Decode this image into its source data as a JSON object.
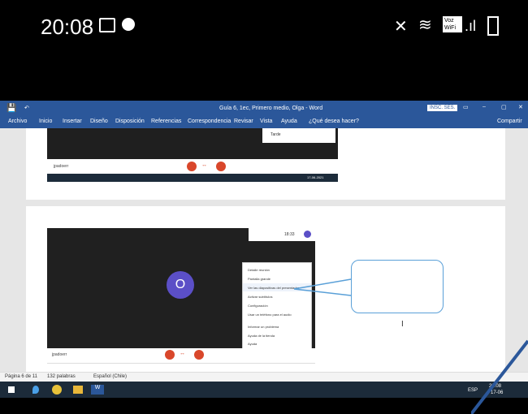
{
  "phone": {
    "time": "20:08",
    "voice_label": "Voz WiFi"
  },
  "word": {
    "title": "Guía 6, 1ec, Primero medio, Olga - Word",
    "badge": "INSC. SES.",
    "share": "Compartir",
    "tell_me": "¿Qué desea hacer?",
    "menu": [
      "Archivo",
      "Inicio",
      "Insertar",
      "Diseño",
      "Disposición",
      "Referencias",
      "Correspondencia",
      "Revisar",
      "Vista",
      "Ayuda"
    ]
  },
  "doc": {
    "top_video": {
      "user": "jpadoerr",
      "popup_item": "Tarde",
      "timestamp_small": "17-06-2021"
    },
    "video": {
      "avatar_letter": "O",
      "user": "jpadoerr",
      "clock": "18:33"
    },
    "menu_items": [
      "Detalle reunión",
      "Pantalla grande",
      "Ver las diapositivas del presentador",
      "Activar subtítulos",
      "Configuración",
      "Usar un teléfono para el audio",
      "Informar un problema",
      "Ayuda de la tienda",
      "Ayuda"
    ]
  },
  "status": {
    "page": "Página 6 de 11",
    "words": "132 palabras",
    "lang": "Español (Chile)"
  },
  "taskbar": {
    "lang": "ESP",
    "time": "20:08",
    "date": "17-06"
  },
  "colors": {
    "word_blue": "#2b579a",
    "callout": "#5aa0d8",
    "avatar": "#5b4fc7",
    "end_call": "#d9472b"
  }
}
